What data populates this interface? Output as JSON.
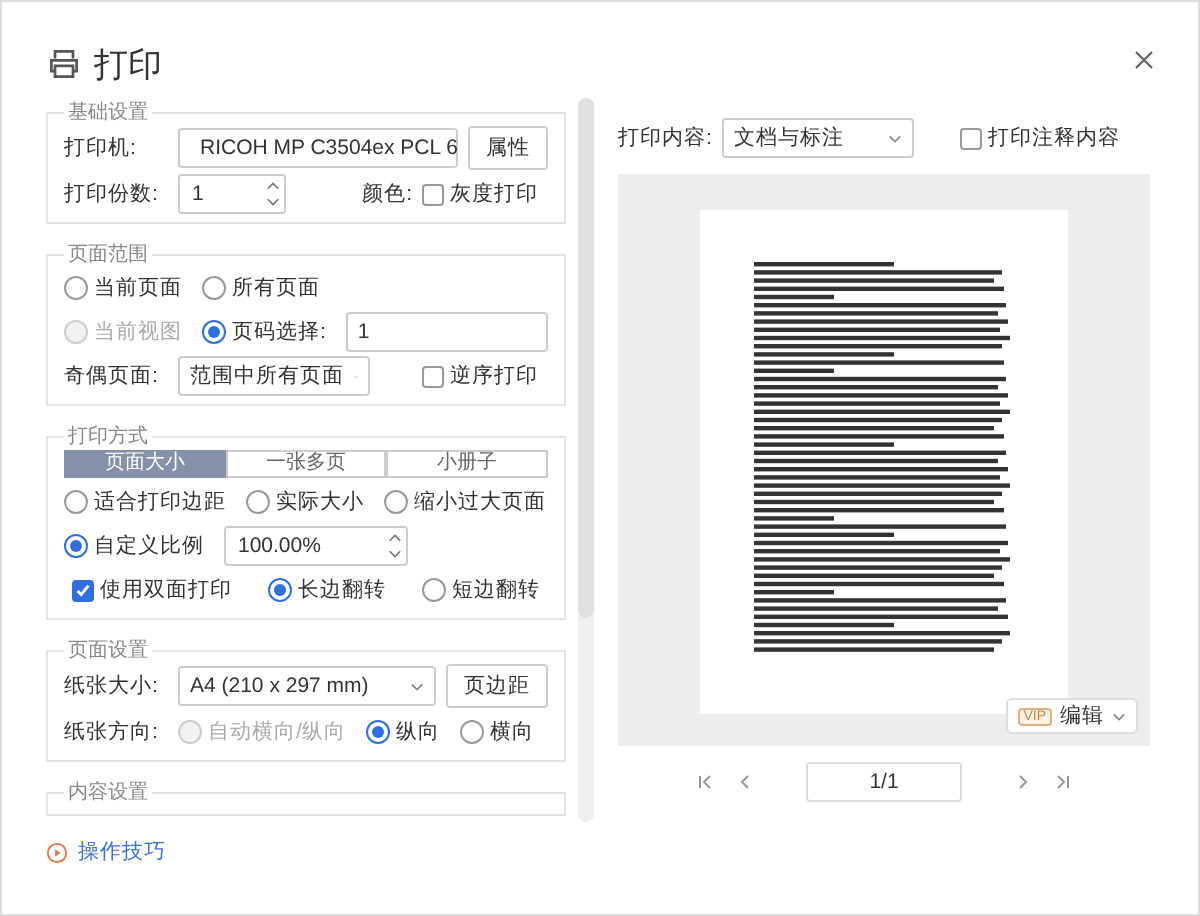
{
  "title": "打印",
  "basic": {
    "legend": "基础设置",
    "printer_label": "打印机:",
    "printer": "RICOH MP C3504ex PCL 6",
    "properties_button": "属性",
    "copies_label": "打印份数:",
    "copies": "1",
    "color_label": "颜色:",
    "grayscale": {
      "label": "灰度打印",
      "checked": false
    }
  },
  "page_range": {
    "legend": "页面范围",
    "options": [
      {
        "label": "当前页面",
        "selected": false,
        "disabled": false
      },
      {
        "label": "所有页面",
        "selected": false,
        "disabled": false
      },
      {
        "label": "当前视图",
        "selected": false,
        "disabled": true
      },
      {
        "label": "页码选择:",
        "selected": true,
        "disabled": false
      }
    ],
    "pages_value": "1",
    "odd_even_label": "奇偶页面:",
    "odd_even": "范围中所有页面",
    "reverse": {
      "label": "逆序打印",
      "checked": false
    }
  },
  "print_mode": {
    "legend": "打印方式",
    "tabs": [
      {
        "label": "页面大小",
        "selected": true
      },
      {
        "label": "一张多页",
        "selected": false
      },
      {
        "label": "小册子",
        "selected": false
      }
    ],
    "scaling": [
      {
        "label": "适合打印边距",
        "selected": false
      },
      {
        "label": "实际大小",
        "selected": false
      },
      {
        "label": "缩小过大页面",
        "selected": false
      },
      {
        "label": "自定义比例",
        "selected": true
      }
    ],
    "scale_value": "100.00%",
    "duplex": {
      "label": "使用双面打印",
      "checked": true
    },
    "flip": [
      {
        "label": "长边翻转",
        "selected": true
      },
      {
        "label": "短边翻转",
        "selected": false
      }
    ]
  },
  "page_setup": {
    "legend": "页面设置",
    "paper_label": "纸张大小:",
    "paper": "A4 (210 x 297 mm)",
    "margins_button": "页边距",
    "orientation_label": "纸张方向:",
    "orientation": [
      {
        "label": "自动横向/纵向",
        "selected": false,
        "disabled": true
      },
      {
        "label": "纵向",
        "selected": true,
        "disabled": false
      },
      {
        "label": "横向",
        "selected": false,
        "disabled": false
      }
    ]
  },
  "content_setup": {
    "legend": "内容设置"
  },
  "tips_link": "操作技巧",
  "preview": {
    "content_label": "打印内容:",
    "content": "文档与标注",
    "annotations": {
      "label": "打印注释内容",
      "checked": false
    },
    "vip_badge": "VIP",
    "edit_button": "编辑",
    "page": "1/1"
  }
}
